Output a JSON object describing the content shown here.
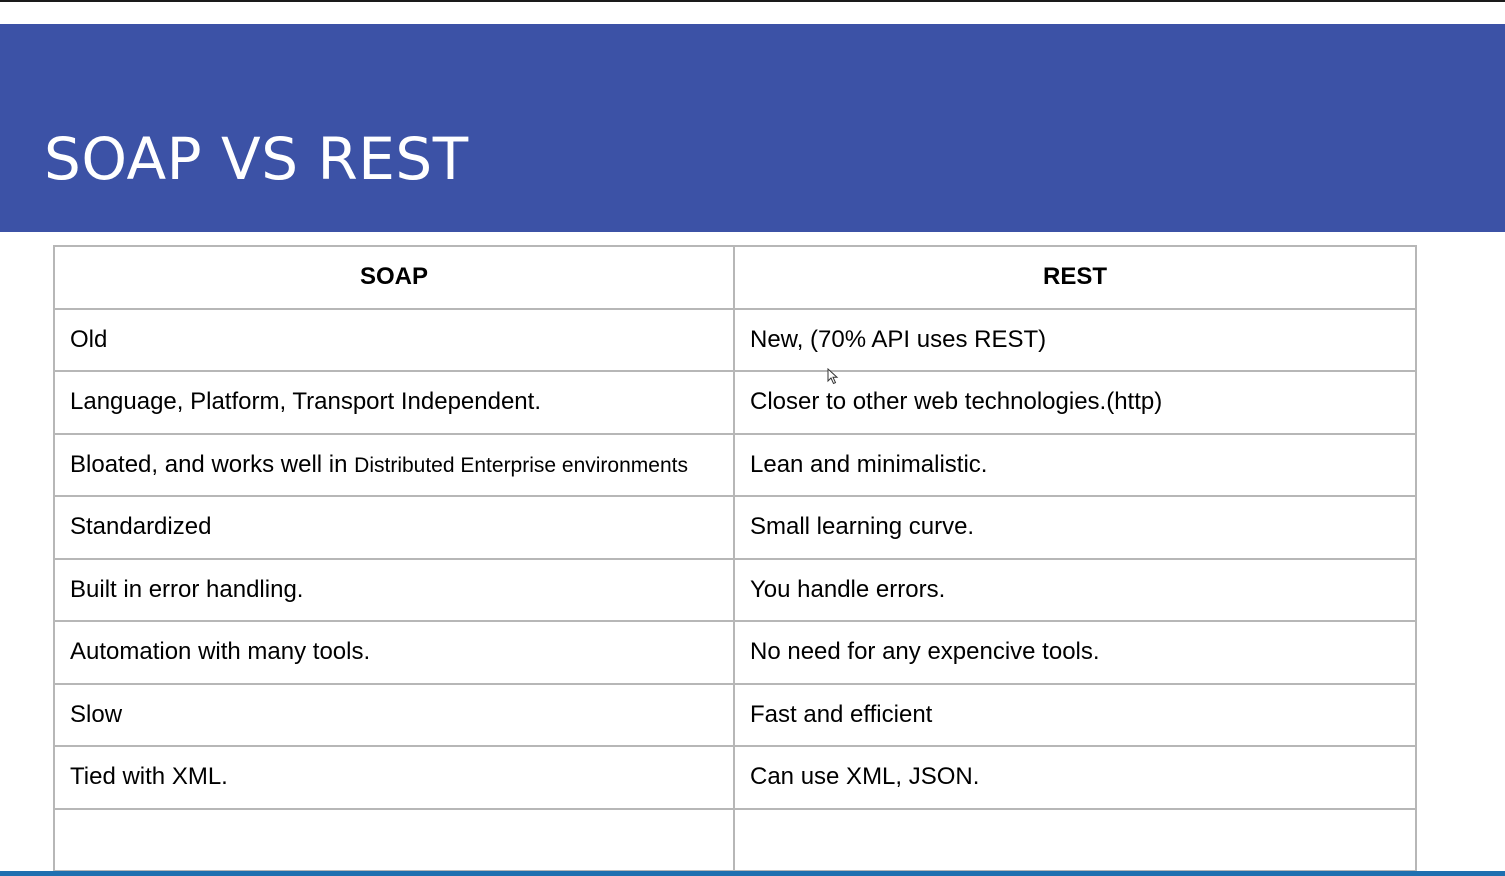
{
  "slide": {
    "title": "SOAP VS REST"
  },
  "table": {
    "headers": [
      "SOAP",
      "REST"
    ],
    "rows": [
      {
        "soap": "Old",
        "rest": "New, (70% API uses REST)"
      },
      {
        "soap": "Language, Platform, Transport Independent.",
        "rest": "Closer to other web technologies.(http)"
      },
      {
        "soap": "Bloated, and works well in",
        "soap_small": "Distributed Enterprise environments",
        "rest": "Lean and minimalistic."
      },
      {
        "soap": "Standardized",
        "rest": "Small learning curve."
      },
      {
        "soap": "Built in error handling.",
        "rest": "You handle errors."
      },
      {
        "soap": "Automation with many tools.",
        "rest": "No need for any expencive tools."
      },
      {
        "soap": "Slow",
        "rest": "Fast and efficient"
      },
      {
        "soap": "Tied with XML.",
        "rest": "Can use XML, JSON."
      },
      {
        "soap": "",
        "rest": ""
      }
    ]
  },
  "colors": {
    "header_bg": "#3c52a6",
    "title_text": "#ffffff",
    "border": "#b7b7b7"
  },
  "icons": {
    "cursor": "mouse-pointer-icon"
  }
}
